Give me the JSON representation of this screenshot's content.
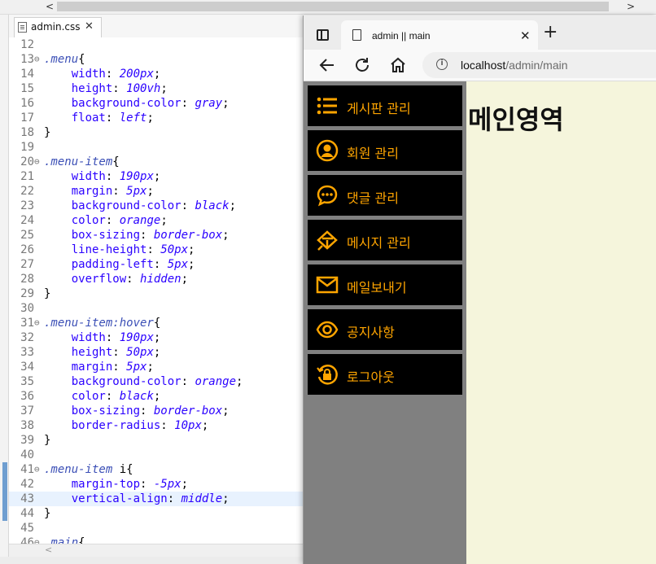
{
  "editor": {
    "tab_label": "admin.css",
    "lines": [
      {
        "n": "12",
        "fold": "",
        "parts": []
      },
      {
        "n": "13",
        "fold": "⊖",
        "parts": [
          [
            "sel",
            ".menu"
          ],
          [
            "pun",
            "{"
          ]
        ]
      },
      {
        "n": "14",
        "fold": "",
        "parts": [
          [
            "ind",
            "    "
          ],
          [
            "prop",
            "width"
          ],
          [
            "pun",
            ": "
          ],
          [
            "val",
            "200px"
          ],
          [
            "pun",
            ";"
          ]
        ]
      },
      {
        "n": "15",
        "fold": "",
        "parts": [
          [
            "ind",
            "    "
          ],
          [
            "prop",
            "height"
          ],
          [
            "pun",
            ": "
          ],
          [
            "val",
            "100vh"
          ],
          [
            "pun",
            ";"
          ]
        ]
      },
      {
        "n": "16",
        "fold": "",
        "parts": [
          [
            "ind",
            "    "
          ],
          [
            "prop",
            "background-color"
          ],
          [
            "pun",
            ": "
          ],
          [
            "val",
            "gray"
          ],
          [
            "pun",
            ";"
          ]
        ]
      },
      {
        "n": "17",
        "fold": "",
        "parts": [
          [
            "ind",
            "    "
          ],
          [
            "prop",
            "float"
          ],
          [
            "pun",
            ": "
          ],
          [
            "val",
            "left"
          ],
          [
            "pun",
            ";"
          ]
        ]
      },
      {
        "n": "18",
        "fold": "",
        "parts": [
          [
            "pun",
            "}"
          ]
        ]
      },
      {
        "n": "19",
        "fold": "",
        "parts": []
      },
      {
        "n": "20",
        "fold": "⊖",
        "parts": [
          [
            "sel",
            ".menu-item"
          ],
          [
            "pun",
            "{"
          ]
        ]
      },
      {
        "n": "21",
        "fold": "",
        "parts": [
          [
            "ind",
            "    "
          ],
          [
            "prop",
            "width"
          ],
          [
            "pun",
            ": "
          ],
          [
            "val",
            "190px"
          ],
          [
            "pun",
            ";"
          ]
        ]
      },
      {
        "n": "22",
        "fold": "",
        "parts": [
          [
            "ind",
            "    "
          ],
          [
            "prop",
            "margin"
          ],
          [
            "pun",
            ": "
          ],
          [
            "val",
            "5px"
          ],
          [
            "pun",
            ";"
          ]
        ]
      },
      {
        "n": "23",
        "fold": "",
        "parts": [
          [
            "ind",
            "    "
          ],
          [
            "prop",
            "background-color"
          ],
          [
            "pun",
            ": "
          ],
          [
            "val",
            "black"
          ],
          [
            "pun",
            ";"
          ]
        ]
      },
      {
        "n": "24",
        "fold": "",
        "parts": [
          [
            "ind",
            "    "
          ],
          [
            "prop",
            "color"
          ],
          [
            "pun",
            ": "
          ],
          [
            "val",
            "orange"
          ],
          [
            "pun",
            ";"
          ]
        ]
      },
      {
        "n": "25",
        "fold": "",
        "parts": [
          [
            "ind",
            "    "
          ],
          [
            "prop",
            "box-sizing"
          ],
          [
            "pun",
            ": "
          ],
          [
            "val",
            "border-box"
          ],
          [
            "pun",
            ";"
          ]
        ]
      },
      {
        "n": "26",
        "fold": "",
        "parts": [
          [
            "ind",
            "    "
          ],
          [
            "prop",
            "line-height"
          ],
          [
            "pun",
            ": "
          ],
          [
            "val",
            "50px"
          ],
          [
            "pun",
            ";"
          ]
        ]
      },
      {
        "n": "27",
        "fold": "",
        "parts": [
          [
            "ind",
            "    "
          ],
          [
            "prop",
            "padding-left"
          ],
          [
            "pun",
            ": "
          ],
          [
            "val",
            "5px"
          ],
          [
            "pun",
            ";"
          ]
        ]
      },
      {
        "n": "28",
        "fold": "",
        "parts": [
          [
            "ind",
            "    "
          ],
          [
            "prop",
            "overflow"
          ],
          [
            "pun",
            ": "
          ],
          [
            "val",
            "hidden"
          ],
          [
            "pun",
            ";"
          ]
        ]
      },
      {
        "n": "29",
        "fold": "",
        "parts": [
          [
            "pun",
            "}"
          ]
        ]
      },
      {
        "n": "30",
        "fold": "",
        "parts": []
      },
      {
        "n": "31",
        "fold": "⊖",
        "parts": [
          [
            "sel",
            ".menu-item:hover"
          ],
          [
            "pun",
            "{"
          ]
        ]
      },
      {
        "n": "32",
        "fold": "",
        "parts": [
          [
            "ind",
            "    "
          ],
          [
            "prop",
            "width"
          ],
          [
            "pun",
            ": "
          ],
          [
            "val",
            "190px"
          ],
          [
            "pun",
            ";"
          ]
        ]
      },
      {
        "n": "33",
        "fold": "",
        "parts": [
          [
            "ind",
            "    "
          ],
          [
            "prop",
            "height"
          ],
          [
            "pun",
            ": "
          ],
          [
            "val",
            "50px"
          ],
          [
            "pun",
            ";"
          ]
        ]
      },
      {
        "n": "34",
        "fold": "",
        "parts": [
          [
            "ind",
            "    "
          ],
          [
            "prop",
            "margin"
          ],
          [
            "pun",
            ": "
          ],
          [
            "val",
            "5px"
          ],
          [
            "pun",
            ";"
          ]
        ]
      },
      {
        "n": "35",
        "fold": "",
        "parts": [
          [
            "ind",
            "    "
          ],
          [
            "prop",
            "background-color"
          ],
          [
            "pun",
            ": "
          ],
          [
            "val",
            "orange"
          ],
          [
            "pun",
            ";"
          ]
        ]
      },
      {
        "n": "36",
        "fold": "",
        "parts": [
          [
            "ind",
            "    "
          ],
          [
            "prop",
            "color"
          ],
          [
            "pun",
            ": "
          ],
          [
            "val",
            "black"
          ],
          [
            "pun",
            ";"
          ]
        ]
      },
      {
        "n": "37",
        "fold": "",
        "parts": [
          [
            "ind",
            "    "
          ],
          [
            "prop",
            "box-sizing"
          ],
          [
            "pun",
            ": "
          ],
          [
            "val",
            "border-box"
          ],
          [
            "pun",
            ";"
          ]
        ]
      },
      {
        "n": "38",
        "fold": "",
        "parts": [
          [
            "ind",
            "    "
          ],
          [
            "prop",
            "border-radius"
          ],
          [
            "pun",
            ": "
          ],
          [
            "val",
            "10px"
          ],
          [
            "pun",
            ";"
          ]
        ]
      },
      {
        "n": "39",
        "fold": "",
        "parts": [
          [
            "pun",
            "}"
          ]
        ]
      },
      {
        "n": "40",
        "fold": "",
        "parts": []
      },
      {
        "n": "41",
        "fold": "⊖",
        "parts": [
          [
            "sel",
            ".menu-item "
          ],
          [
            "pun",
            "i{"
          ]
        ]
      },
      {
        "n": "42",
        "fold": "",
        "parts": [
          [
            "ind",
            "    "
          ],
          [
            "prop",
            "margin-top"
          ],
          [
            "pun",
            ": "
          ],
          [
            "val",
            "-5px"
          ],
          [
            "pun",
            ";"
          ]
        ]
      },
      {
        "n": "43",
        "fold": "",
        "parts": [
          [
            "ind",
            "    "
          ],
          [
            "prop",
            "vertical-align"
          ],
          [
            "pun",
            ": "
          ],
          [
            "val",
            "middle"
          ],
          [
            "pun",
            ";"
          ]
        ]
      },
      {
        "n": "44",
        "fold": "",
        "parts": [
          [
            "pun",
            "}"
          ]
        ]
      },
      {
        "n": "45",
        "fold": "",
        "parts": []
      },
      {
        "n": "46",
        "fold": "⊖",
        "parts": [
          [
            "sel",
            ".main"
          ],
          [
            "pun",
            "{"
          ]
        ]
      }
    ]
  },
  "browser": {
    "tab_title": "admin || main",
    "url_host": "localhost",
    "url_path": "/admin/main",
    "menu_items": [
      {
        "label": "게시판 관리",
        "icon": "list-icon"
      },
      {
        "label": "회원 관리",
        "icon": "account-circle-icon"
      },
      {
        "label": "댓글 관리",
        "icon": "comment-dots-icon"
      },
      {
        "label": "메시지 관리",
        "icon": "message-sign-icon"
      },
      {
        "label": "메일보내기",
        "icon": "mail-icon"
      },
      {
        "label": "공지사항",
        "icon": "eye-icon"
      },
      {
        "label": "로그아웃",
        "icon": "logout-lock-icon"
      }
    ],
    "main_heading": "메인영역",
    "accent_color": "#ffa500"
  }
}
